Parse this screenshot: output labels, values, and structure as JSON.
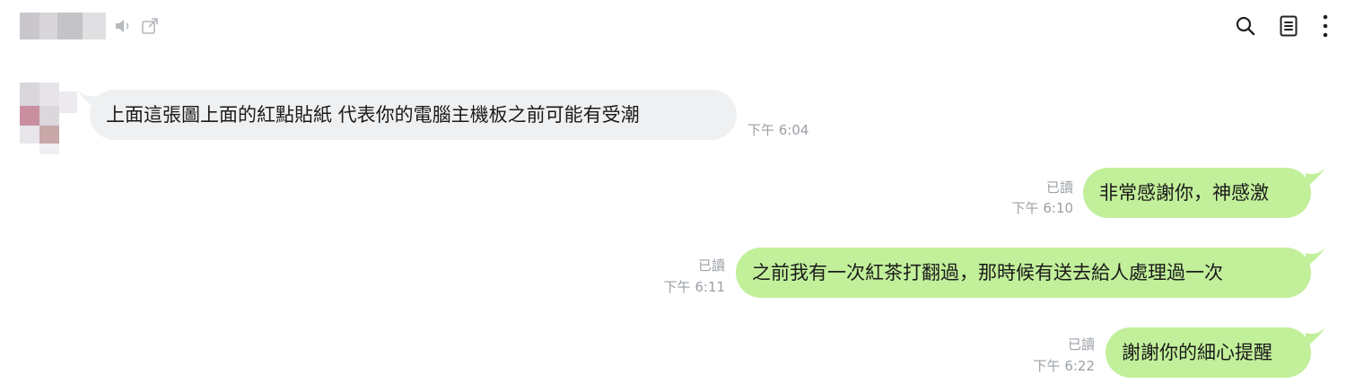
{
  "header": {
    "icons": [
      "mute-icon",
      "external-link-icon",
      "search-icon",
      "notes-icon",
      "more-vertical-icon"
    ]
  },
  "messages": [
    {
      "direction": "incoming",
      "text": "上面這張圖上面的紅點貼紙 代表你的電腦主機板之前可能有受潮",
      "time": "下午 6:04"
    },
    {
      "direction": "outgoing",
      "text": "非常感謝你，神感激",
      "read": "已讀",
      "time": "下午 6:10"
    },
    {
      "direction": "outgoing",
      "text": "之前我有一次紅茶打翻過，那時候有送去給人處理過一次",
      "read": "已讀",
      "time": "下午 6:11"
    },
    {
      "direction": "outgoing",
      "text": "謝謝你的細心提醒",
      "read": "已讀",
      "time": "下午 6:22"
    }
  ],
  "colors": {
    "incoming_bubble": "#eef0f2",
    "outgoing_bubble": "#c2ef9a",
    "meta_text": "#9ba0a6"
  }
}
